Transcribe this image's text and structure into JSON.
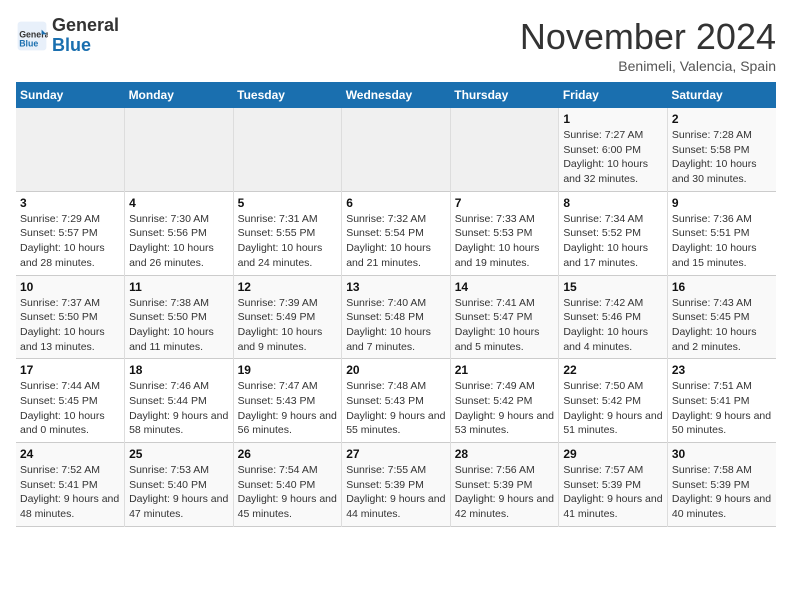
{
  "header": {
    "logo_general": "General",
    "logo_blue": "Blue",
    "month": "November 2024",
    "location": "Benimeli, Valencia, Spain"
  },
  "calendar": {
    "days_of_week": [
      "Sunday",
      "Monday",
      "Tuesday",
      "Wednesday",
      "Thursday",
      "Friday",
      "Saturday"
    ],
    "weeks": [
      [
        {
          "day": "",
          "info": ""
        },
        {
          "day": "",
          "info": ""
        },
        {
          "day": "",
          "info": ""
        },
        {
          "day": "",
          "info": ""
        },
        {
          "day": "",
          "info": ""
        },
        {
          "day": "1",
          "info": "Sunrise: 7:27 AM\nSunset: 6:00 PM\nDaylight: 10 hours and 32 minutes."
        },
        {
          "day": "2",
          "info": "Sunrise: 7:28 AM\nSunset: 5:58 PM\nDaylight: 10 hours and 30 minutes."
        }
      ],
      [
        {
          "day": "3",
          "info": "Sunrise: 7:29 AM\nSunset: 5:57 PM\nDaylight: 10 hours and 28 minutes."
        },
        {
          "day": "4",
          "info": "Sunrise: 7:30 AM\nSunset: 5:56 PM\nDaylight: 10 hours and 26 minutes."
        },
        {
          "day": "5",
          "info": "Sunrise: 7:31 AM\nSunset: 5:55 PM\nDaylight: 10 hours and 24 minutes."
        },
        {
          "day": "6",
          "info": "Sunrise: 7:32 AM\nSunset: 5:54 PM\nDaylight: 10 hours and 21 minutes."
        },
        {
          "day": "7",
          "info": "Sunrise: 7:33 AM\nSunset: 5:53 PM\nDaylight: 10 hours and 19 minutes."
        },
        {
          "day": "8",
          "info": "Sunrise: 7:34 AM\nSunset: 5:52 PM\nDaylight: 10 hours and 17 minutes."
        },
        {
          "day": "9",
          "info": "Sunrise: 7:36 AM\nSunset: 5:51 PM\nDaylight: 10 hours and 15 minutes."
        }
      ],
      [
        {
          "day": "10",
          "info": "Sunrise: 7:37 AM\nSunset: 5:50 PM\nDaylight: 10 hours and 13 minutes."
        },
        {
          "day": "11",
          "info": "Sunrise: 7:38 AM\nSunset: 5:50 PM\nDaylight: 10 hours and 11 minutes."
        },
        {
          "day": "12",
          "info": "Sunrise: 7:39 AM\nSunset: 5:49 PM\nDaylight: 10 hours and 9 minutes."
        },
        {
          "day": "13",
          "info": "Sunrise: 7:40 AM\nSunset: 5:48 PM\nDaylight: 10 hours and 7 minutes."
        },
        {
          "day": "14",
          "info": "Sunrise: 7:41 AM\nSunset: 5:47 PM\nDaylight: 10 hours and 5 minutes."
        },
        {
          "day": "15",
          "info": "Sunrise: 7:42 AM\nSunset: 5:46 PM\nDaylight: 10 hours and 4 minutes."
        },
        {
          "day": "16",
          "info": "Sunrise: 7:43 AM\nSunset: 5:45 PM\nDaylight: 10 hours and 2 minutes."
        }
      ],
      [
        {
          "day": "17",
          "info": "Sunrise: 7:44 AM\nSunset: 5:45 PM\nDaylight: 10 hours and 0 minutes."
        },
        {
          "day": "18",
          "info": "Sunrise: 7:46 AM\nSunset: 5:44 PM\nDaylight: 9 hours and 58 minutes."
        },
        {
          "day": "19",
          "info": "Sunrise: 7:47 AM\nSunset: 5:43 PM\nDaylight: 9 hours and 56 minutes."
        },
        {
          "day": "20",
          "info": "Sunrise: 7:48 AM\nSunset: 5:43 PM\nDaylight: 9 hours and 55 minutes."
        },
        {
          "day": "21",
          "info": "Sunrise: 7:49 AM\nSunset: 5:42 PM\nDaylight: 9 hours and 53 minutes."
        },
        {
          "day": "22",
          "info": "Sunrise: 7:50 AM\nSunset: 5:42 PM\nDaylight: 9 hours and 51 minutes."
        },
        {
          "day": "23",
          "info": "Sunrise: 7:51 AM\nSunset: 5:41 PM\nDaylight: 9 hours and 50 minutes."
        }
      ],
      [
        {
          "day": "24",
          "info": "Sunrise: 7:52 AM\nSunset: 5:41 PM\nDaylight: 9 hours and 48 minutes."
        },
        {
          "day": "25",
          "info": "Sunrise: 7:53 AM\nSunset: 5:40 PM\nDaylight: 9 hours and 47 minutes."
        },
        {
          "day": "26",
          "info": "Sunrise: 7:54 AM\nSunset: 5:40 PM\nDaylight: 9 hours and 45 minutes."
        },
        {
          "day": "27",
          "info": "Sunrise: 7:55 AM\nSunset: 5:39 PM\nDaylight: 9 hours and 44 minutes."
        },
        {
          "day": "28",
          "info": "Sunrise: 7:56 AM\nSunset: 5:39 PM\nDaylight: 9 hours and 42 minutes."
        },
        {
          "day": "29",
          "info": "Sunrise: 7:57 AM\nSunset: 5:39 PM\nDaylight: 9 hours and 41 minutes."
        },
        {
          "day": "30",
          "info": "Sunrise: 7:58 AM\nSunset: 5:39 PM\nDaylight: 9 hours and 40 minutes."
        }
      ]
    ]
  }
}
